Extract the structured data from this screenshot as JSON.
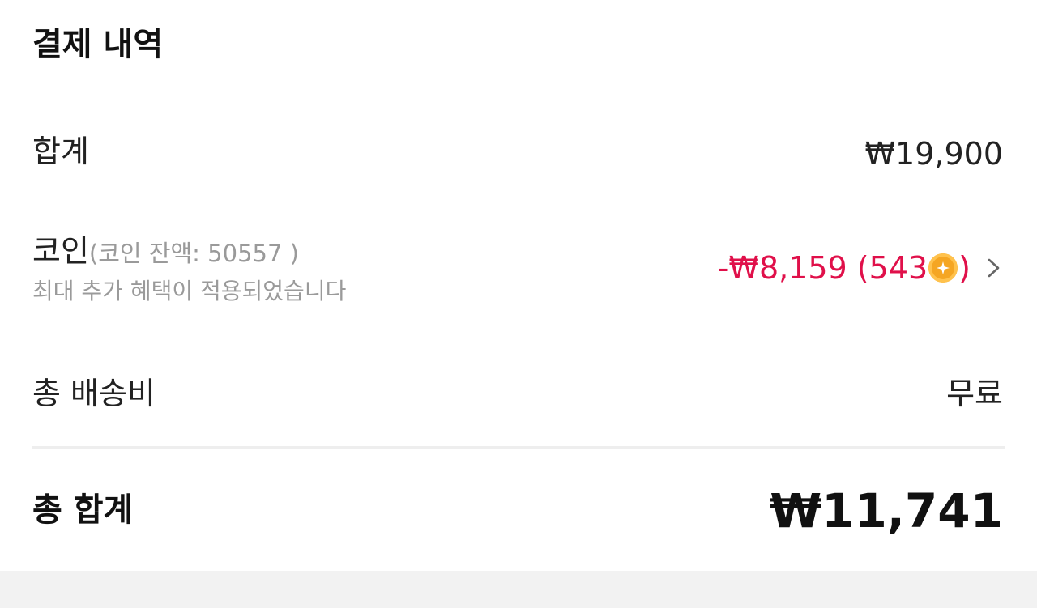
{
  "section": {
    "title": "결제 내역"
  },
  "subtotal": {
    "label": "합계",
    "value": "₩19,900"
  },
  "coin": {
    "label": "코인",
    "balance_text": "(코인 잔액: 50557 )",
    "note": "최대 추가 혜택이 적용되었습니다",
    "discount_prefix": "-₩8,159 (",
    "coins_used": "543",
    "discount_suffix": ")",
    "icon": "coin-icon",
    "chevron_icon": "chevron-right-icon",
    "color": "#e0104a"
  },
  "shipping": {
    "label": "총 배송비",
    "value": "무료"
  },
  "total": {
    "label": "총 합계",
    "value": "₩11,741"
  }
}
